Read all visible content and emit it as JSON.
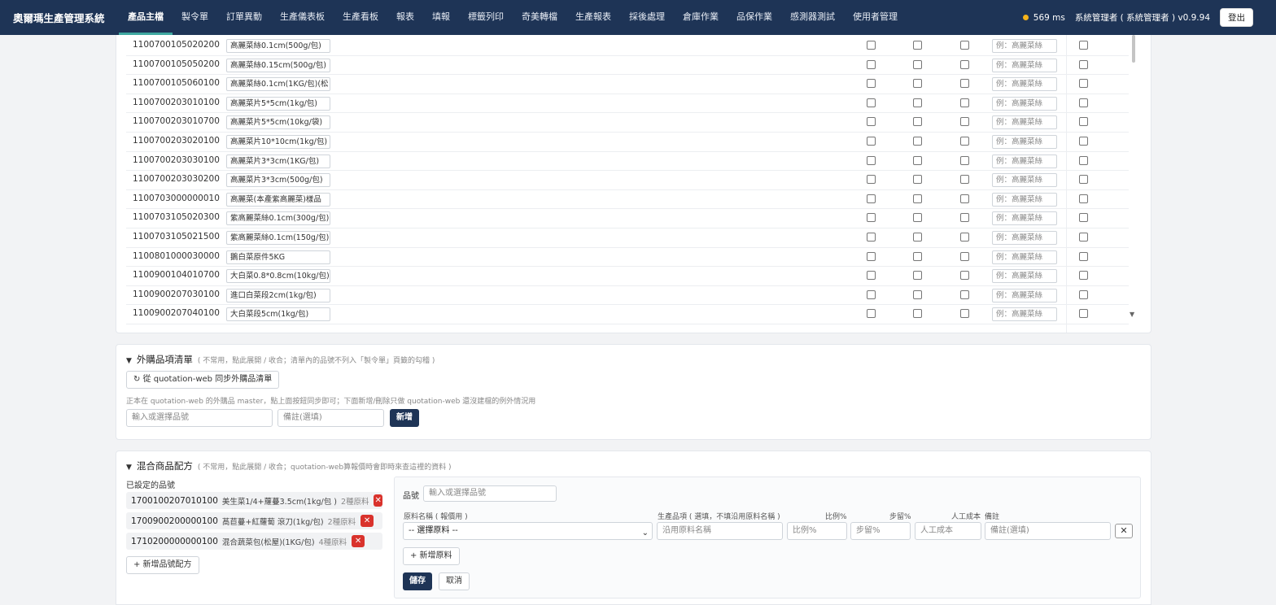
{
  "nav": {
    "brand": "奧爾瑪生產管理系統",
    "menu": [
      "產品主檔",
      "製令單",
      "訂單異動",
      "生產儀表板",
      "生產看板",
      "報表",
      "填報",
      "標籤列印",
      "奇美轉檔",
      "生產報表",
      "採後處理",
      "倉庫作業",
      "品保作業",
      "感測器測試",
      "使用者管理"
    ],
    "active_index": 0,
    "latency": "569 ms",
    "user": "系統管理者 ( 系統管理者 ) v0.9.94",
    "logout": "登出"
  },
  "product_table": {
    "example_placeholder": "例：高麗菜絲",
    "rows": [
      {
        "code": "1100700105020200",
        "name": "高麗菜絲0.1cm(500g/包)"
      },
      {
        "code": "1100700105050200",
        "name": "高麗菜絲0.15cm(500g/包)"
      },
      {
        "code": "1100700105060100",
        "name": "高麗菜絲0.1cm(1KG/包)(松"
      },
      {
        "code": "1100700203010100",
        "name": "高麗菜片5*5cm(1kg/包)"
      },
      {
        "code": "1100700203010700",
        "name": "高麗菜片5*5cm(10kg/袋)"
      },
      {
        "code": "1100700203020100",
        "name": "高麗菜片10*10cm(1kg/包)"
      },
      {
        "code": "1100700203030100",
        "name": "高麗菜片3*3cm(1KG/包)"
      },
      {
        "code": "1100700203030200",
        "name": "高麗菜片3*3cm(500g/包)"
      },
      {
        "code": "1100703000000010",
        "name": "高麗菜(本產紫高麗菜)樣品"
      },
      {
        "code": "1100703105020300",
        "name": "紫高麗菜絲0.1cm(300g/包)"
      },
      {
        "code": "1100703105021500",
        "name": "紫高麗菜絲0.1cm(150g/包)"
      },
      {
        "code": "1100801000030000",
        "name": "鵝白菜原件5KG"
      },
      {
        "code": "1100900104010700",
        "name": "大白菜0.8*0.8cm(10kg/包)"
      },
      {
        "code": "1100900207030100",
        "name": "進口白菜段2cm(1kg/包)"
      },
      {
        "code": "1100900207040100",
        "name": "大白菜段5cm(1kg/包)"
      }
    ]
  },
  "external": {
    "title": "外購品項清單",
    "note": "( 不常用，點此展開 / 收合；清單內的品號不列入「製令單」頁籤的勾稽 )",
    "sync_button": "↻ 從 quotation-web 同步外購品清單",
    "helper": "正本在 quotation-web 的外購品 master，點上面按鈕同步即可；下面新增/刪除只做 quotation-web 還沒建檔的例外情況用",
    "item_placeholder": "輸入或選擇品號",
    "remark_placeholder": "備註(選填)",
    "add_button": "新增"
  },
  "mix": {
    "title": "混合商品配方",
    "note": "( 不常用，點此展開 / 收合；quotation-web算報價時會即時來查這裡的資料 )",
    "set_label": "已設定的品號",
    "items": [
      {
        "code": "1700100207010100",
        "name": "美生菜1/4+蘿蔓3.5cm(1kg/包 )",
        "count": "2種原料"
      },
      {
        "code": "1700900200000100",
        "name": "萵苣蔓+紅蘿蔔 滾刀(1kg/包)",
        "count": "2種原料"
      },
      {
        "code": "1710200000000100",
        "name": "混合蔬菜包(松屋)(1KG/包)",
        "count": "4種原料"
      }
    ],
    "add_formula": "+ 新增品號配方",
    "form": {
      "item_label": "品號",
      "item_placeholder": "輸入或選擇品號",
      "col_material": "原料名稱 ( 報價用 )",
      "col_production": "生產品項 ( 選填，不填沿用原料名稱 )",
      "col_ratio": "比例%",
      "col_yield": "步留%",
      "col_labor": "人工成本",
      "col_remark": "備註",
      "select_placeholder": "-- 選擇原料 --",
      "production_placeholder": "沿用原料名稱",
      "ratio_placeholder": "比例%",
      "yield_placeholder": "步留%",
      "labor_placeholder": "人工成本",
      "remark_placeholder": "備註(選填)",
      "remove": "✕",
      "add_material": "+ 新增原料",
      "save": "儲存",
      "cancel": "取消"
    }
  }
}
